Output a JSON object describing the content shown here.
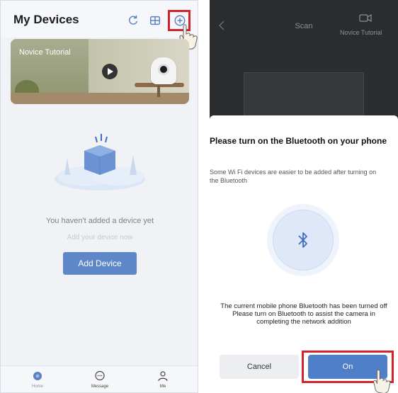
{
  "left_screen": {
    "title": "My Devices",
    "header_icons": [
      "refresh-icon",
      "layout-icon",
      "add-circle-icon"
    ],
    "banner": {
      "title": "Novice Tutorial"
    },
    "empty_state": {
      "message": "You haven't added a device yet",
      "sub_message": "Add your device now",
      "add_button_label": "Add Device"
    },
    "tabs": [
      {
        "label": "Home",
        "icon": "home-icon"
      },
      {
        "label": "Message",
        "icon": "message-icon"
      },
      {
        "label": "Me",
        "icon": "person-icon"
      }
    ]
  },
  "right_screen": {
    "header": {
      "title": "Scan",
      "tutorial_label": "Novice Tutorial"
    },
    "dialog": {
      "title": "Please turn on the Bluetooth on your phone",
      "description": "Some Wi Fi devices are easier to be added after turning on the Bluetooth",
      "status_line1": "The current mobile phone Bluetooth has been turned off",
      "status_line2": "Please turn on Bluetooth to assist the camera in completing the network addition",
      "cancel_label": "Cancel",
      "on_label": "On"
    }
  },
  "colors": {
    "primary_button": "#5d87c9",
    "highlight_box": "#d3232b",
    "scan_background": "#2b2c2e"
  }
}
